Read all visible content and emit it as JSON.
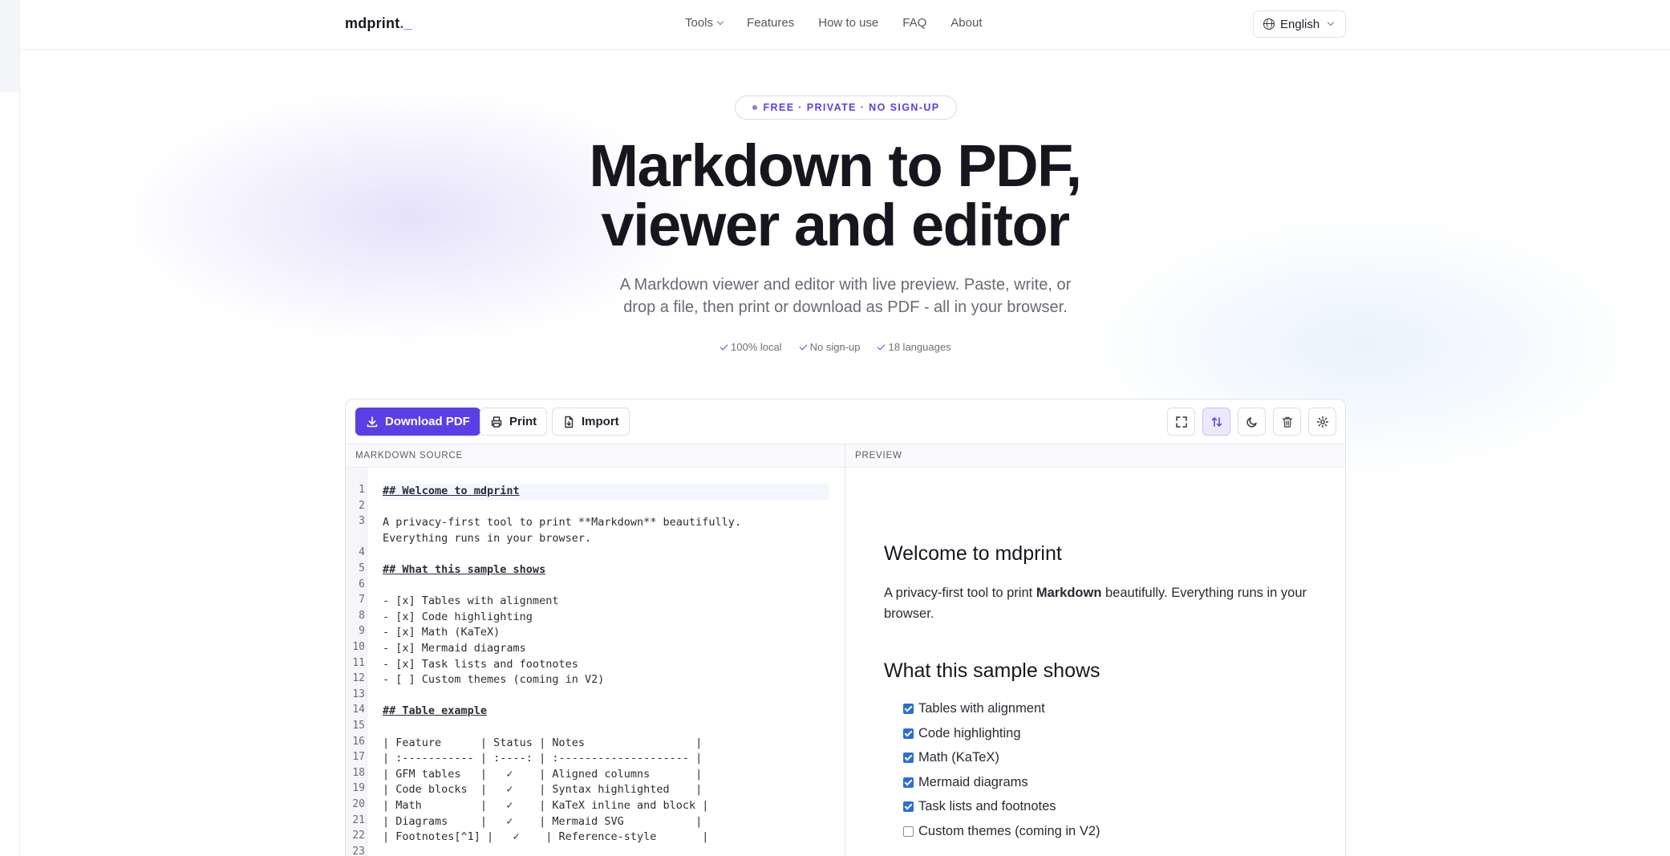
{
  "header": {
    "logo": "mdprint",
    "logo_suffix": "._",
    "nav": [
      {
        "label": "Tools"
      },
      {
        "label": "Features"
      },
      {
        "label": "How to use"
      },
      {
        "label": "FAQ"
      },
      {
        "label": "About"
      }
    ],
    "language": "English"
  },
  "hero": {
    "badge": "FREE · PRIVATE · NO SIGN-UP",
    "title_line1": "Markdown to PDF,",
    "title_line2": "viewer and editor",
    "subtitle_line1": "A Markdown viewer and editor with live preview. Paste, write, or",
    "subtitle_line2": "drop a file, then print or download as PDF - all in your browser.",
    "checks": [
      "100% local",
      "No sign-up",
      "18 languages"
    ]
  },
  "toolbar": {
    "download": "Download PDF",
    "print": "Print",
    "import": "Import",
    "icons": [
      "fullscreen-icon",
      "sync-scroll-icon",
      "theme-moon-icon",
      "trash-icon",
      "settings-icon"
    ]
  },
  "source": {
    "heading": "MARKDOWN SOURCE",
    "line_numbers": [
      "1",
      "2",
      "3",
      "4",
      "5",
      "6",
      "7",
      "8",
      "9",
      "10",
      "11",
      "12",
      "13",
      "14",
      "15",
      "16",
      "17",
      "18",
      "19",
      "20",
      "21",
      "22",
      "23"
    ],
    "lines": [
      "## Welcome to mdprint",
      "",
      "A privacy-first tool to print **Markdown** beautifully.",
      "Everything runs in your browser.",
      "",
      "## What this sample shows",
      "",
      "- [x] Tables with alignment",
      "- [x] Code highlighting",
      "- [x] Math (KaTeX)",
      "- [x] Mermaid diagrams",
      "- [x] Task lists and footnotes",
      "- [ ] Custom themes (coming in V2)",
      "",
      "## Table example",
      "",
      "| Feature      | Status | Notes                 |",
      "| :----------- | :----: | :-------------------- |",
      "| GFM tables   |   ✓    | Aligned columns       |",
      "| Code blocks  |   ✓    | Syntax highlighted    |",
      "| Math         |   ✓    | KaTeX inline and block |",
      "| Diagrams     |   ✓    | Mermaid SVG           |",
      "| Footnotes[^1] |   ✓    | Reference-style       |"
    ]
  },
  "preview": {
    "heading": "PREVIEW",
    "h2_1": "Welcome to mdprint",
    "para_before": "A privacy-first tool to print ",
    "para_bold": "Markdown",
    "para_after": " beautifully. Everything runs in your browser.",
    "h2_2": "What this sample shows",
    "tasks": [
      {
        "label": "Tables with alignment",
        "checked": true
      },
      {
        "label": "Code highlighting",
        "checked": true
      },
      {
        "label": "Math (KaTeX)",
        "checked": true
      },
      {
        "label": "Mermaid diagrams",
        "checked": true
      },
      {
        "label": "Task lists and footnotes",
        "checked": true
      },
      {
        "label": "Custom themes (coming in V2)",
        "checked": false
      }
    ]
  },
  "colors": {
    "accent": "#5b3fe6",
    "checkbox": "#2a6fd6"
  }
}
